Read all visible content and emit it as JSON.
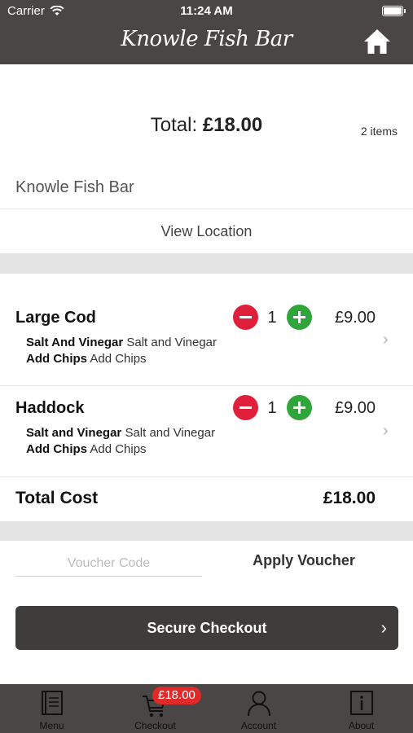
{
  "status": {
    "carrier": "Carrier",
    "time": "11:24 AM"
  },
  "header": {
    "brand": "Knowle Fish Bar"
  },
  "summary": {
    "total_prefix": "Total: ",
    "total_value": "£18.00",
    "items_count": "2 items"
  },
  "shop": {
    "name": "Knowle Fish Bar",
    "view_location": "View Location"
  },
  "items": [
    {
      "name": "Large Cod",
      "qty": "1",
      "price": "£9.00",
      "options": [
        {
          "label": "Salt And Vinegar",
          "value": "Salt and Vinegar"
        },
        {
          "label": "Add Chips",
          "value": "Add Chips"
        }
      ]
    },
    {
      "name": "Haddock",
      "qty": "1",
      "price": "£9.00",
      "options": [
        {
          "label": "Salt and Vinegar",
          "value": "Salt and Vinegar"
        },
        {
          "label": "Add Chips",
          "value": "Add Chips"
        }
      ]
    }
  ],
  "total_cost": {
    "label": "Total Cost",
    "value": "£18.00"
  },
  "voucher": {
    "placeholder": "Voucher Code",
    "apply_label": "Apply Voucher"
  },
  "checkout": {
    "label": "Secure Checkout"
  },
  "tabs": [
    {
      "label": "Menu",
      "icon": "menu-book-icon"
    },
    {
      "label": "Checkout",
      "icon": "cart-icon",
      "badge": "£18.00"
    },
    {
      "label": "Account",
      "icon": "user-icon"
    },
    {
      "label": "About",
      "icon": "info-icon"
    }
  ],
  "colors": {
    "bar": "#4a4646",
    "minus": "#e0203a",
    "plus": "#2fa53b",
    "badge": "#e02a2a",
    "checkout": "#3f3c3c"
  }
}
